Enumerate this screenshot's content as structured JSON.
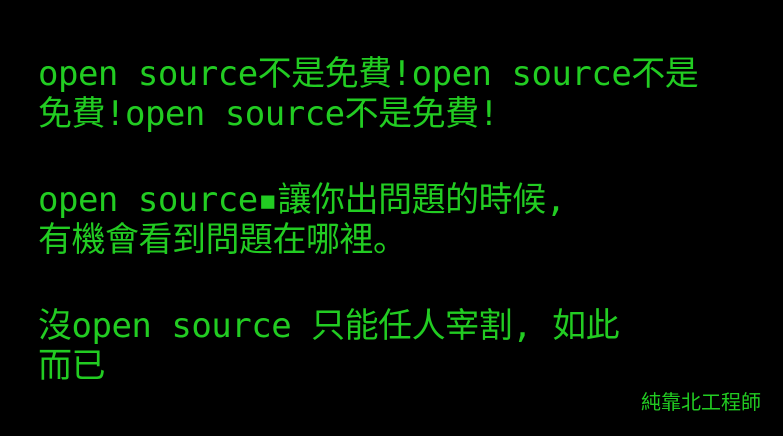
{
  "paragraph1": {
    "line1": "open source不是免費!open source不是",
    "line2": "免費!open source不是免費!"
  },
  "paragraph2": {
    "line1": "open source▪讓你出問題的時候,",
    "line2": "有機會看到問題在哪裡。"
  },
  "paragraph3": {
    "line1": "沒open source 只能任人宰割, 如此",
    "line2": "而已"
  },
  "signature": "純靠北工程師",
  "colors": {
    "background": "#000000",
    "text": "#22cc22"
  }
}
